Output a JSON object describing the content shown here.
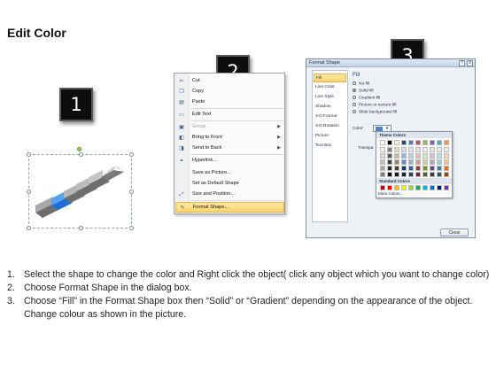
{
  "title": "Edit Color",
  "badges": [
    "1",
    "2",
    "3"
  ],
  "context_menu": {
    "items": [
      {
        "icon": "scissors-icon",
        "glyph": "✂",
        "label": "Cut",
        "disabled": false,
        "submenu": false
      },
      {
        "icon": "copy-icon",
        "glyph": "❐",
        "label": "Copy",
        "disabled": false,
        "submenu": false
      },
      {
        "icon": "paste-icon",
        "glyph": "▤",
        "label": "Paste",
        "disabled": false,
        "submenu": false
      },
      {
        "icon": "edit-text-icon",
        "glyph": "▭",
        "label": "Edit Text",
        "disabled": false,
        "submenu": false
      },
      {
        "icon": "group-icon",
        "glyph": "▣",
        "label": "Group",
        "disabled": true,
        "submenu": true
      },
      {
        "icon": "bring-to-front-icon",
        "glyph": "◧",
        "label": "Bring to Front",
        "disabled": false,
        "submenu": true
      },
      {
        "icon": "send-to-back-icon",
        "glyph": "◨",
        "label": "Send to Back",
        "disabled": false,
        "submenu": true
      },
      {
        "icon": "hyperlink-icon",
        "glyph": "⚭",
        "label": "Hyperlink...",
        "disabled": false,
        "submenu": false
      },
      {
        "icon": "",
        "glyph": "",
        "label": "Save as Picture...",
        "disabled": false,
        "submenu": false
      },
      {
        "icon": "",
        "glyph": "",
        "label": "Set as Default Shape",
        "disabled": false,
        "submenu": false
      },
      {
        "icon": "size-position-icon",
        "glyph": "⤢",
        "label": "Size and Position...",
        "disabled": false,
        "submenu": false
      },
      {
        "icon": "format-shape-icon",
        "glyph": "✎",
        "label": "Format Shape...",
        "disabled": false,
        "submenu": false,
        "highlighted": true
      }
    ]
  },
  "dialog": {
    "title": "Format Shape",
    "help_label": "?",
    "close_label": "x",
    "categories": [
      "Fill",
      "Line Color",
      "Line Style",
      "Shadow",
      "3-D Format",
      "3-D Rotation",
      "Picture",
      "Text Box"
    ],
    "selected_category": "Fill",
    "fill_heading": "Fill",
    "fill_options": [
      {
        "label": "No fill",
        "selected": false
      },
      {
        "label": "Solid fill",
        "selected": true
      },
      {
        "label": "Gradient fill",
        "selected": false
      },
      {
        "label": "Picture or texture fill",
        "selected": false
      },
      {
        "label": "Slide background fill",
        "selected": false
      }
    ],
    "color_label": "Color:",
    "transparency_label": "Transpa",
    "close_button": "Close"
  },
  "palette": {
    "theme_heading": "Theme Colors",
    "theme_top": [
      "#ffffff",
      "#000000",
      "#eeece1",
      "#1f497d",
      "#4f81bd",
      "#c0504d",
      "#9bbb59",
      "#8064a2",
      "#4bacc6",
      "#f79646"
    ],
    "theme_shades": [
      [
        "#f2f2f2",
        "#7f7f7f",
        "#ddd9c3",
        "#c6d9f0",
        "#dbe5f1",
        "#f2dcdb",
        "#ebf1dd",
        "#e5e0ec",
        "#dbeef3",
        "#fdeada"
      ],
      [
        "#d8d8d8",
        "#595959",
        "#c4bd97",
        "#8db3e2",
        "#b8cce4",
        "#e5b9b7",
        "#d7e3bc",
        "#ccc1d9",
        "#b7dde8",
        "#fbd5b5"
      ],
      [
        "#bfbfbf",
        "#3f3f3f",
        "#938953",
        "#548dd4",
        "#95b3d7",
        "#d99694",
        "#c3d69b",
        "#b2a2c7",
        "#92cddc",
        "#fac08f"
      ],
      [
        "#a5a5a5",
        "#262626",
        "#494429",
        "#17365d",
        "#366092",
        "#953734",
        "#76923c",
        "#5f497a",
        "#31859b",
        "#e36c09"
      ],
      [
        "#7f7f7f",
        "#0c0c0c",
        "#1d1b10",
        "#0f243e",
        "#244061",
        "#632423",
        "#4f6128",
        "#3f3151",
        "#205867",
        "#974806"
      ]
    ],
    "standard_heading": "Standard Colors",
    "standard": [
      "#c00000",
      "#ff0000",
      "#ffc000",
      "#ffff00",
      "#92d050",
      "#00b050",
      "#00b0f0",
      "#0070c0",
      "#002060",
      "#7030a0"
    ],
    "more_label": "More Colors..."
  },
  "instructions": [
    {
      "num": "1.",
      "text": "Select the shape to change the color and Right click the object( click any object which you want to change color)"
    },
    {
      "num": "2.",
      "text": "Choose Format Shape in the dialog box."
    },
    {
      "num": "3.",
      "text": "Choose “Fill” in the Format Shape box then “Solid” or “Gradient” depending on the appearance of the object. Change colour as shown in the picture."
    }
  ],
  "colors": {
    "badge": "#0d0d0d",
    "highlight": "#fbd46a",
    "shape_accent": "#1e6fd9",
    "shape_gray": "#8c8c8c"
  }
}
